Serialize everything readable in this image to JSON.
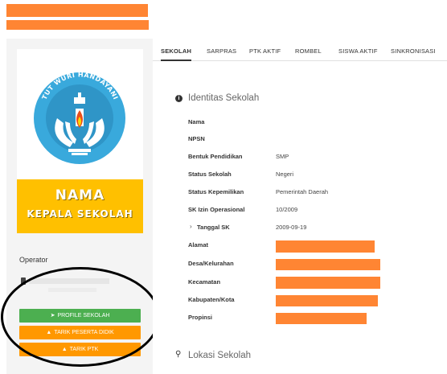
{
  "sidebar": {
    "logo_motto": "TUT WURI HANDAYANI",
    "name_line1": "NAMA",
    "name_line2": "KEPALA SEKOLAH",
    "operator_label": "Operator",
    "buttons": {
      "profile": "PROFILE SEKOLAH",
      "tarik_peserta": "TARIK PESERTA DIDIK",
      "tarik_ptk": "TARIK PTK"
    }
  },
  "tabs": [
    "SEKOLAH",
    "SARPRAS",
    "PTK AKTIF",
    "ROMBEL",
    "SISWA AKTIF",
    "SINKRONISASI"
  ],
  "identitas": {
    "title": "Identitas Sekolah",
    "fields": {
      "nama": "Nama",
      "npsn": "NPSN",
      "bentuk_label": "Bentuk Pendidikan",
      "bentuk_value": "SMP",
      "status_label": "Status Sekolah",
      "status_value": "Negeri",
      "kepemilikan_label": "Status Kepemilikan",
      "kepemilikan_value": "Pemerintah Daerah",
      "sk_label": "SK Izin Operasional",
      "sk_value": "10/2009",
      "tanggal_label": "Tanggal SK",
      "tanggal_value": "2009-09-19",
      "alamat": "Alamat",
      "desa": "Desa/Kelurahan",
      "kecamatan": "Kecamatan",
      "kabupaten": "Kabupaten/Kota",
      "propinsi": "Propinsi"
    }
  },
  "lokasi": {
    "title": "Lokasi Sekolah"
  },
  "colors": {
    "accent_green": "#4caf50",
    "accent_orange": "#ff9800",
    "redaction": "#ff8533",
    "name_box": "#ffc000"
  }
}
